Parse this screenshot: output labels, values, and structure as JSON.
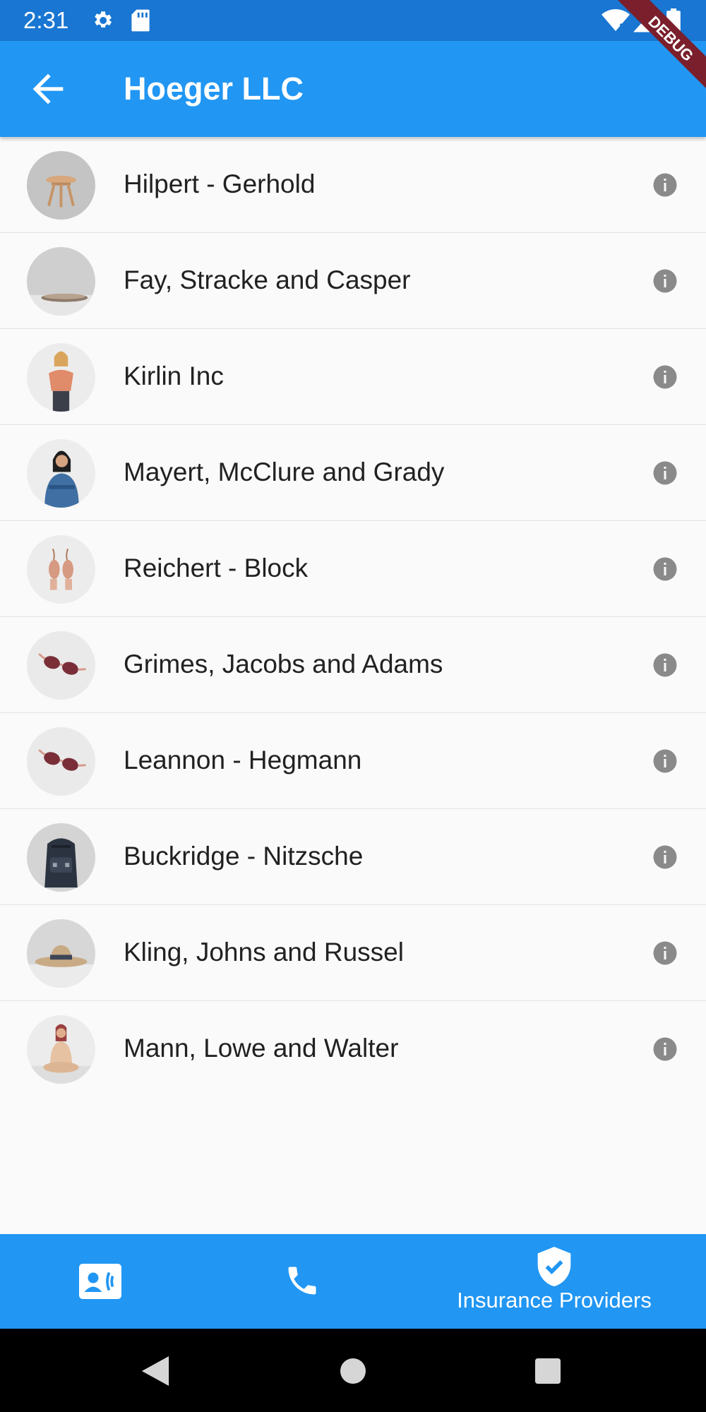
{
  "status_bar": {
    "time": "2:31",
    "icons": [
      "settings-icon",
      "sd-card-icon",
      "wifi-icon",
      "signal-icon",
      "battery-icon"
    ]
  },
  "app_bar": {
    "title": "Hoeger LLC",
    "back_icon": "arrow-back-icon"
  },
  "debug_banner": {
    "label": "DEBUG"
  },
  "list": {
    "items": [
      {
        "label": "Hilpert - Gerhold",
        "image": "wooden-stool"
      },
      {
        "label": "Fay, Stracke and Casper",
        "image": "bowl"
      },
      {
        "label": "Kirlin Inc",
        "image": "woman-orange-top"
      },
      {
        "label": "Mayert, McClure and Grady",
        "image": "woman-denim-shirt"
      },
      {
        "label": "Reichert - Block",
        "image": "earrings"
      },
      {
        "label": "Grimes, Jacobs and Adams",
        "image": "sunglasses"
      },
      {
        "label": "Leannon - Hegmann",
        "image": "sunglasses"
      },
      {
        "label": "Buckridge - Nitzsche",
        "image": "backpack"
      },
      {
        "label": "Kling, Johns and Russel",
        "image": "hat"
      },
      {
        "label": "Mann, Lowe and Walter",
        "image": "woman-sitting"
      }
    ],
    "trailing_icon": "info-icon"
  },
  "bottom_nav": {
    "items": [
      {
        "icon": "contact-card-icon",
        "label": "",
        "selected": false
      },
      {
        "icon": "phone-icon",
        "label": "",
        "selected": false
      },
      {
        "icon": "verified-shield-icon",
        "label": "Insurance Providers",
        "selected": true
      }
    ]
  },
  "system_nav": {
    "icons": [
      "back-triangle-icon",
      "home-circle-icon",
      "recents-square-icon"
    ]
  },
  "colors": {
    "status_bar": "#1976d2",
    "primary": "#2196f3",
    "background": "#fafafa",
    "text": "#212121",
    "info_icon": "#8a8a8a",
    "debug_banner": "#7a1f2b"
  }
}
